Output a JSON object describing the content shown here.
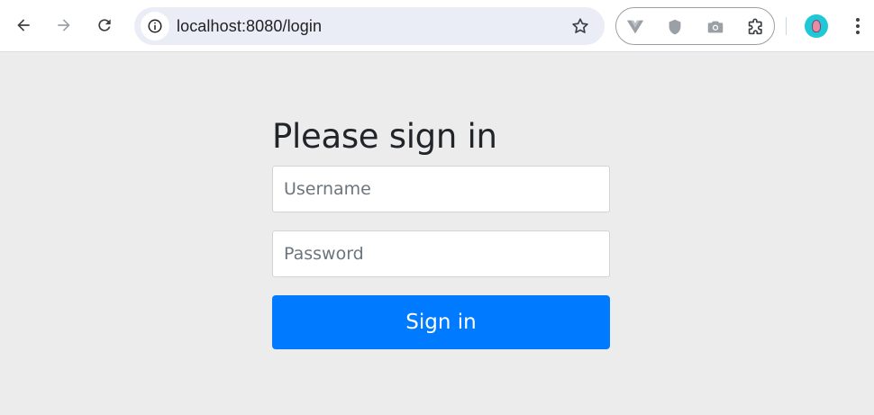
{
  "browser": {
    "url": "localhost:8080/login",
    "icons": {
      "back": "arrow-left-icon",
      "forward": "arrow-right-icon",
      "reload": "reload-icon",
      "site_info": "info-icon",
      "bookmark": "star-icon",
      "extensions": [
        "vue-devtools-icon",
        "shield-icon",
        "camera-icon",
        "puzzle-icon"
      ],
      "menu": "kebab-menu-icon"
    }
  },
  "login": {
    "heading": "Please sign in",
    "username_placeholder": "Username",
    "username_value": "",
    "password_placeholder": "Password",
    "password_value": "",
    "submit_label": "Sign in"
  },
  "colors": {
    "page_background": "#ececec",
    "primary_button": "#007bff",
    "heading_text": "#212529"
  }
}
